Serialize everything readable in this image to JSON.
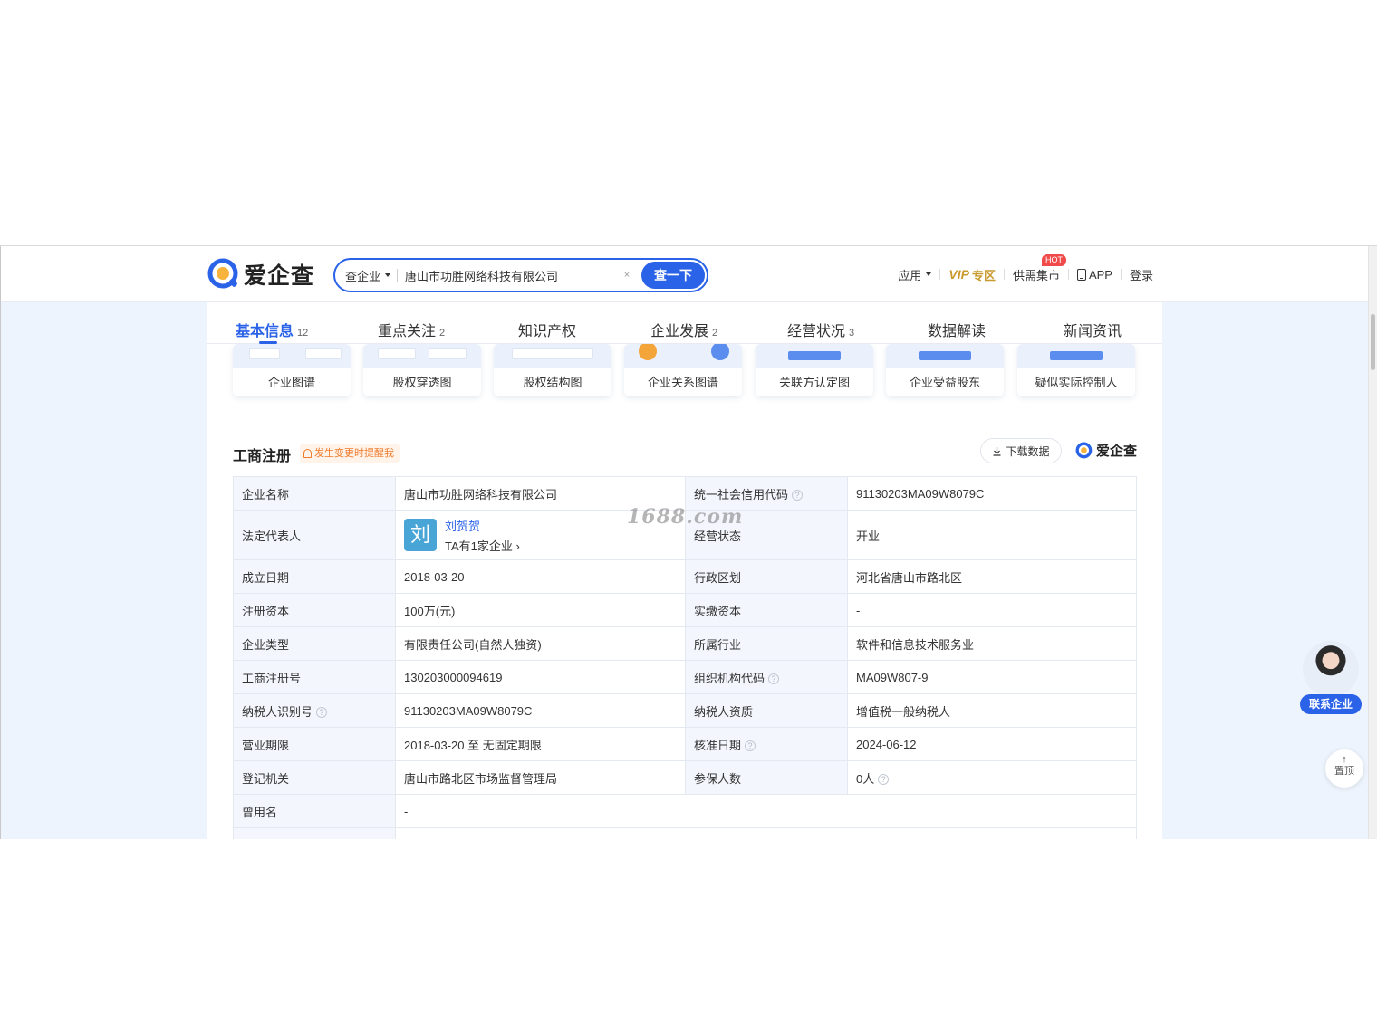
{
  "header": {
    "logo_text": "爱企查",
    "search_type": "查企业",
    "search_value": "唐山市功胜网络科技有限公司",
    "search_clear": "×",
    "search_button": "查一下",
    "nav": {
      "apps": "应用",
      "vip": "VIP",
      "vip_suffix": "专区",
      "supply": "供需集市",
      "hot_badge": "HOT",
      "app": "APP",
      "login": "登录"
    }
  },
  "tabs": [
    {
      "label": "基本信息",
      "count": "12"
    },
    {
      "label": "重点关注",
      "count": "2"
    },
    {
      "label": "知识产权",
      "count": ""
    },
    {
      "label": "企业发展",
      "count": "2"
    },
    {
      "label": "经营状况",
      "count": "3"
    },
    {
      "label": "数据解读",
      "count": ""
    },
    {
      "label": "新闻资讯",
      "count": ""
    }
  ],
  "graph_cards": [
    {
      "label": "企业图谱"
    },
    {
      "label": "股权穿透图"
    },
    {
      "label": "股权结构图"
    },
    {
      "label": "企业关系图谱"
    },
    {
      "label": "关联方认定图"
    },
    {
      "label": "企业受益股东"
    },
    {
      "label": "疑似实际控制人"
    }
  ],
  "section": {
    "title": "工商注册",
    "remind": "发生变更时提醒我",
    "download": "下载数据",
    "brand": "爱企查"
  },
  "registration": {
    "company_name_label": "企业名称",
    "company_name": "唐山市功胜网络科技有限公司",
    "credit_code_label": "统一社会信用代码",
    "credit_code": "91130203MA09W8079C",
    "legal_rep_label": "法定代表人",
    "legal_rep_avatar": "刘",
    "legal_rep_name": "刘贺贺",
    "legal_rep_companies": "TA有1家企业",
    "status_label": "经营状态",
    "status": "开业",
    "founded_label": "成立日期",
    "founded": "2018-03-20",
    "region_label": "行政区划",
    "region": "河北省唐山市路北区",
    "capital_label": "注册资本",
    "capital": "100万(元)",
    "paid_capital_label": "实缴资本",
    "paid_capital": "-",
    "type_label": "企业类型",
    "type": "有限责任公司(自然人独资)",
    "industry_label": "所属行业",
    "industry": "软件和信息技术服务业",
    "reg_no_label": "工商注册号",
    "reg_no": "130203000094619",
    "org_code_label": "组织机构代码",
    "org_code": "MA09W807-9",
    "taxpayer_id_label": "纳税人识别号",
    "taxpayer_id": "91130203MA09W8079C",
    "taxpayer_qual_label": "纳税人资质",
    "taxpayer_qual": "增值税一般纳税人",
    "term_label": "营业期限",
    "term": "2018-03-20 至 无固定期限",
    "approval_label": "核准日期",
    "approval": "2024-06-12",
    "authority_label": "登记机关",
    "authority": "唐山市路北区市场监督管理局",
    "insured_label": "参保人数",
    "insured": "0人",
    "former_name_label": "曾用名",
    "former_name": "-"
  },
  "watermark": "1688.com",
  "float": {
    "contact": "联系企业",
    "top": "置顶"
  },
  "colors": {
    "accent": "#2a62e8",
    "vip": "#c99a2e",
    "remind": "#f07b2b",
    "hot": "#f04a4a"
  }
}
